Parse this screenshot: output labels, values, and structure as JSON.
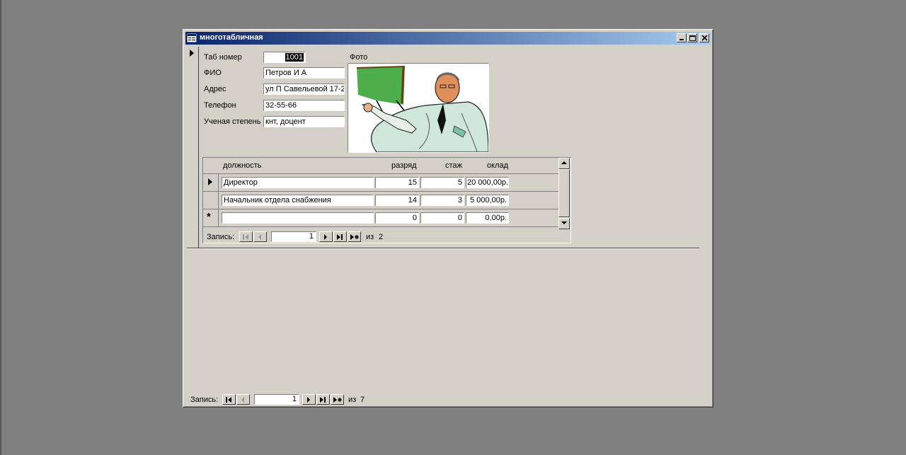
{
  "window": {
    "title": "многотабличная",
    "icon": "form-icon",
    "controls": [
      "minimize-icon",
      "maximize-icon",
      "close-icon"
    ]
  },
  "form": {
    "fields": [
      {
        "label": "Таб номер",
        "value": "1001"
      },
      {
        "label": "ФИО",
        "value": "Петров И А"
      },
      {
        "label": "Адрес",
        "value": "ул П Савельевой 17-2"
      },
      {
        "label": "Телефон",
        "value": "32-55-66"
      },
      {
        "label": "Ученая степень",
        "value": "кнт, доцент"
      }
    ],
    "photo_label": "Фото"
  },
  "subform": {
    "headers": [
      "должность",
      "разряд",
      "стаж",
      "оклад"
    ],
    "rows": [
      {
        "position": "Директор",
        "grade": "15",
        "experience": "5",
        "salary": "20 000,00р."
      },
      {
        "position": "Начальник отдела снабжения",
        "grade": "14",
        "experience": "3",
        "salary": "5 000,00р."
      },
      {
        "position": "",
        "grade": "0",
        "experience": "0",
        "salary": "0,00р."
      }
    ],
    "nav": {
      "label": "Запись:",
      "current": "1",
      "of_label": "из",
      "total": "2"
    }
  },
  "main_nav": {
    "label": "Запись:",
    "current": "1",
    "of_label": "из",
    "total": "7"
  },
  "colors": {
    "title_start": "#0a246a",
    "title_end": "#a6caf0",
    "face": "#d4d0c8",
    "desktop": "#808080"
  }
}
